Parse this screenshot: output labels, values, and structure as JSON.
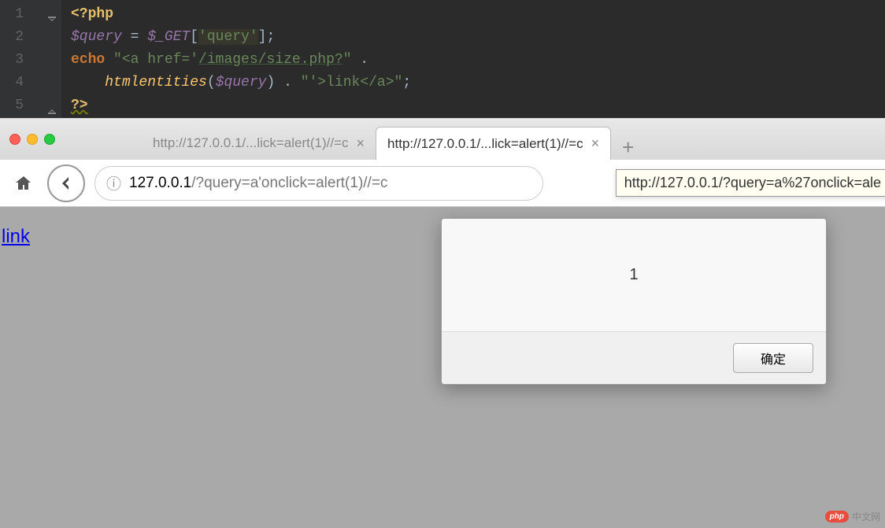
{
  "editor": {
    "lines": [
      "1",
      "2",
      "3",
      "4",
      "5"
    ],
    "code": {
      "l1_open": "<?php",
      "l2_var": "$query",
      "l2_eq": " = ",
      "l2_get": "$_GET",
      "l2_br1": "[",
      "l2_key": "'query'",
      "l2_br2": "]",
      "l2_semi": ";",
      "l3_echo": "echo ",
      "l3_str1": "\"<a href='",
      "l3_url": "/images/size.php?",
      "l3_str1b": "\"",
      "l3_dot": " .",
      "l4_func": "htmlentities",
      "l4_p1": "(",
      "l4_var": "$query",
      "l4_p2": ")",
      "l4_dot": " . ",
      "l4_str2": "\"'>",
      "l4_link": "link",
      "l4_str3": "</a>\"",
      "l4_semi": ";",
      "l5_close": "?>"
    }
  },
  "browser": {
    "tabs": [
      {
        "title": "http://127.0.0.1/...lick=alert(1)//=c",
        "active": false
      },
      {
        "title": "http://127.0.0.1/...lick=alert(1)//=c",
        "active": true
      }
    ],
    "url": {
      "host": "127.0.0.1",
      "path": "/?query=a'onclick=alert(1)//=c"
    },
    "tooltip": "http://127.0.0.1/?query=a%27onclick=ale",
    "page_link": "link",
    "dialog": {
      "message": "1",
      "ok": "确定"
    }
  },
  "watermark": {
    "badge": "php",
    "text": "中文网"
  }
}
